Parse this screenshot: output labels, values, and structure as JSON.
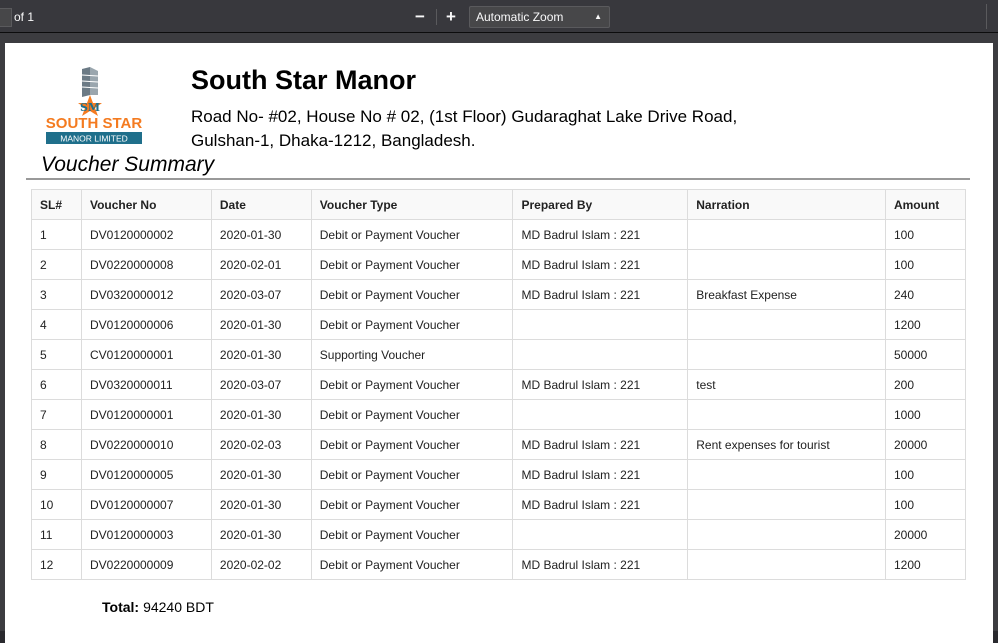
{
  "toolbar": {
    "page_of": "of 1",
    "zoom_out": "−",
    "zoom_in": "+",
    "zoom_value": "Automatic Zoom"
  },
  "header": {
    "logo_text": "SOUTH STAR",
    "logo_subtext": "MANOR LIMITED",
    "logo_mark": "SM",
    "company": "South Star Manor",
    "address_line1": "Road No- #02, House No # 02, (1st Floor) Gudaraghat Lake Drive Road,",
    "address_line2": "Gulshan-1, Dhaka-1212, Bangladesh."
  },
  "title": "Voucher Summary",
  "table": {
    "columns": [
      "SL#",
      "Voucher No",
      "Date",
      "Voucher Type",
      "Prepared By",
      "Narration",
      "Amount"
    ],
    "rows": [
      [
        "1",
        "DV0120000002",
        "2020-01-30",
        "Debit or Payment Voucher",
        "MD Badrul Islam : 221",
        "",
        "100"
      ],
      [
        "2",
        "DV0220000008",
        "2020-02-01",
        "Debit or Payment Voucher",
        "MD Badrul Islam : 221",
        "",
        "100"
      ],
      [
        "3",
        "DV0320000012",
        "2020-03-07",
        "Debit or Payment Voucher",
        "MD Badrul Islam : 221",
        "Breakfast Expense",
        "240"
      ],
      [
        "4",
        "DV0120000006",
        "2020-01-30",
        "Debit or Payment Voucher",
        "",
        "",
        "1200"
      ],
      [
        "5",
        "CV0120000001",
        "2020-01-30",
        "Supporting Voucher",
        "",
        "",
        "50000"
      ],
      [
        "6",
        "DV0320000011",
        "2020-03-07",
        "Debit or Payment Voucher",
        "MD Badrul Islam : 221",
        "test",
        "200"
      ],
      [
        "7",
        "DV0120000001",
        "2020-01-30",
        "Debit or Payment Voucher",
        "",
        "",
        "1000"
      ],
      [
        "8",
        "DV0220000010",
        "2020-02-03",
        "Debit or Payment Voucher",
        "MD Badrul Islam : 221",
        "Rent expenses for tourist",
        "20000"
      ],
      [
        "9",
        "DV0120000005",
        "2020-01-30",
        "Debit or Payment Voucher",
        "MD Badrul Islam : 221",
        "",
        "100"
      ],
      [
        "10",
        "DV0120000007",
        "2020-01-30",
        "Debit or Payment Voucher",
        "MD Badrul Islam : 221",
        "",
        "100"
      ],
      [
        "11",
        "DV0120000003",
        "2020-01-30",
        "Debit or Payment Voucher",
        "",
        "",
        "20000"
      ],
      [
        "12",
        "DV0220000009",
        "2020-02-02",
        "Debit or Payment Voucher",
        "MD Badrul Islam : 221",
        "",
        "1200"
      ]
    ]
  },
  "total": {
    "label": "Total:",
    "value": "94240 BDT"
  },
  "colors": {
    "logo_orange": "#f47b20",
    "logo_teal": "#1f6f8b",
    "toolbar_bg": "#38383d"
  }
}
